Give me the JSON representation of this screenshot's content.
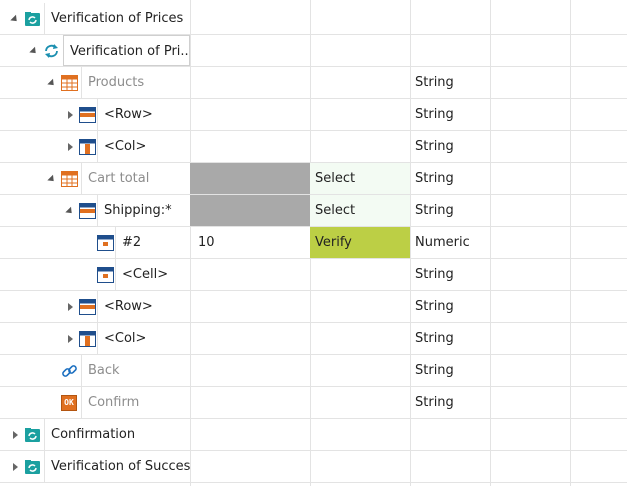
{
  "rows": [
    {
      "label": "Verification of Prices",
      "value": "",
      "action": "",
      "type": ""
    },
    {
      "label": "Verification of Pri...",
      "value": "",
      "action": "",
      "type": ""
    },
    {
      "label": "Products",
      "value": "",
      "action": "",
      "type": "String"
    },
    {
      "label": "<Row>",
      "value": "",
      "action": "",
      "type": "String"
    },
    {
      "label": "<Col>",
      "value": "",
      "action": "",
      "type": "String"
    },
    {
      "label": "Cart total",
      "value": "",
      "action": "Select",
      "type": "String"
    },
    {
      "label": "Shipping:*",
      "value": "",
      "action": "Select",
      "type": "String"
    },
    {
      "label": "#2",
      "value": "10",
      "action": "Verify",
      "type": "Numeric"
    },
    {
      "label": "<Cell>",
      "value": "",
      "action": "",
      "type": "String"
    },
    {
      "label": "<Row>",
      "value": "",
      "action": "",
      "type": "String"
    },
    {
      "label": "<Col>",
      "value": "",
      "action": "",
      "type": "String"
    },
    {
      "label": "Back",
      "value": "",
      "action": "",
      "type": "String"
    },
    {
      "label": "Confirm",
      "value": "",
      "action": "",
      "type": "String"
    },
    {
      "label": "Confirmation",
      "value": "",
      "action": "",
      "type": ""
    },
    {
      "label": "Verification of Success",
      "value": "",
      "action": "",
      "type": ""
    }
  ],
  "icons": {
    "ok_icon_text": "OK"
  },
  "colors": {
    "accent_teal": "#1ba0a0",
    "verify_green": "#bccf45",
    "muted_text": "#8d8d8d"
  }
}
